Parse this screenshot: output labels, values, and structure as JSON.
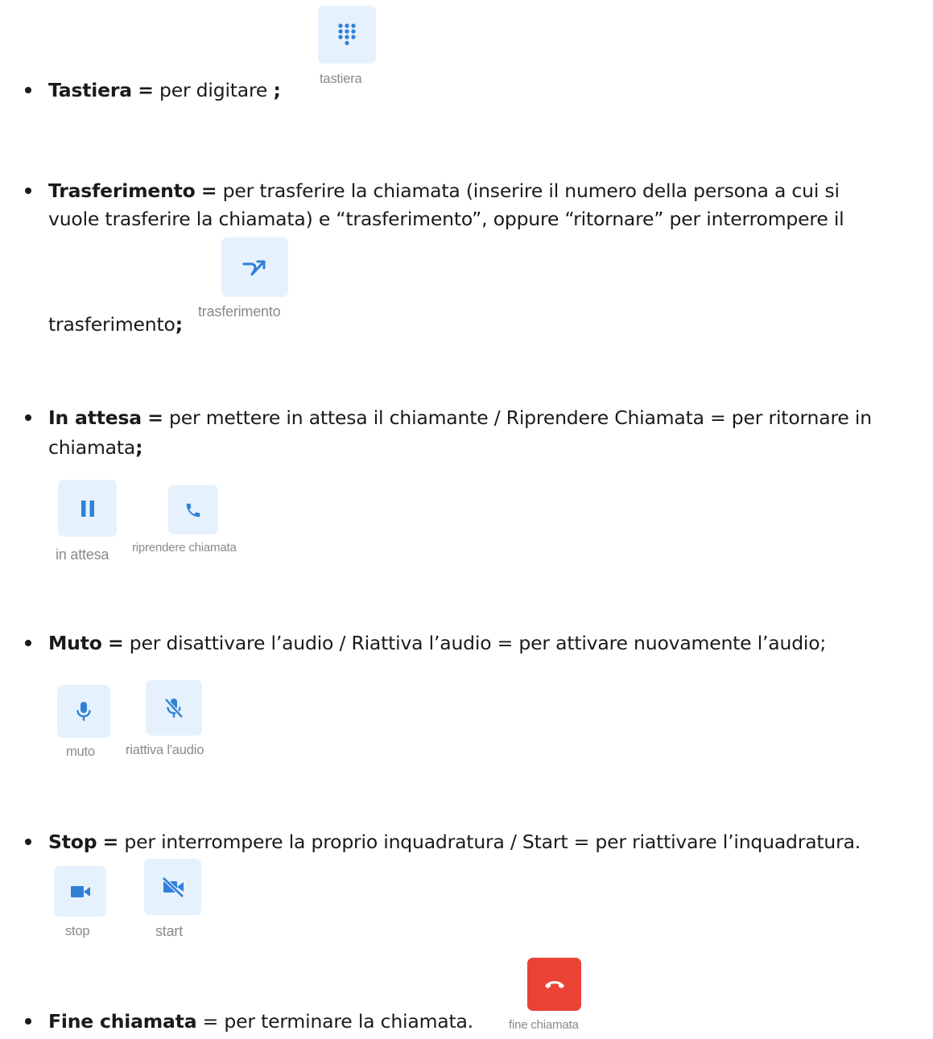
{
  "colors": {
    "tile_bg": "#e5f1fc",
    "icon_blue": "#2f80d7",
    "end_call_red": "#ea4335",
    "caption_gray": "#8a8a8a"
  },
  "items": [
    {
      "term": "Tastiera",
      "eq": "=",
      "desc": " per digitare ",
      "end": ";",
      "buttons": [
        {
          "icon": "dialpad-icon",
          "label": "tastiera"
        }
      ]
    },
    {
      "term": "Trasferimento",
      "eq": "=",
      "line1": " per trasferire la chiamata (inserire il numero della persona a cui si",
      "line2": "vuole trasferire la chiamata) e “trasferimento”, oppure “ritornare” per interrompere il",
      "line3": "trasferimento",
      "end": ";",
      "buttons": [
        {
          "icon": "call-transfer-icon",
          "label": "trasferimento"
        }
      ]
    },
    {
      "term": "In attesa",
      "eq": "=",
      "line1": " per mettere in attesa il chiamante / Riprendere Chiamata = per ritornare in",
      "line2": "chiamata",
      "end": ";",
      "buttons": [
        {
          "icon": "pause-icon",
          "label": "in attesa"
        },
        {
          "icon": "phone-icon",
          "label": "riprendere chiamata"
        }
      ]
    },
    {
      "term": "Muto",
      "eq": "=",
      "desc": " per disattivare l’audio / Riattiva l’audio = per attivare nuovamente l’audio;",
      "buttons": [
        {
          "icon": "microphone-icon",
          "label": "muto"
        },
        {
          "icon": "microphone-off-icon",
          "label": "riattiva l'audio"
        }
      ]
    },
    {
      "term": "Stop",
      "eq": "=",
      "desc": " per interrompere la proprio inquadratura / Start = per riattivare l’inquadratura.",
      "buttons": [
        {
          "icon": "videocam-icon",
          "label": "stop"
        },
        {
          "icon": "videocam-off-icon",
          "label": "start"
        }
      ]
    },
    {
      "term": "Fine chiamata",
      "desc": " = per terminare la chiamata.",
      "buttons": [
        {
          "icon": "end-call-icon",
          "label": "fine chiamata"
        }
      ]
    }
  ]
}
